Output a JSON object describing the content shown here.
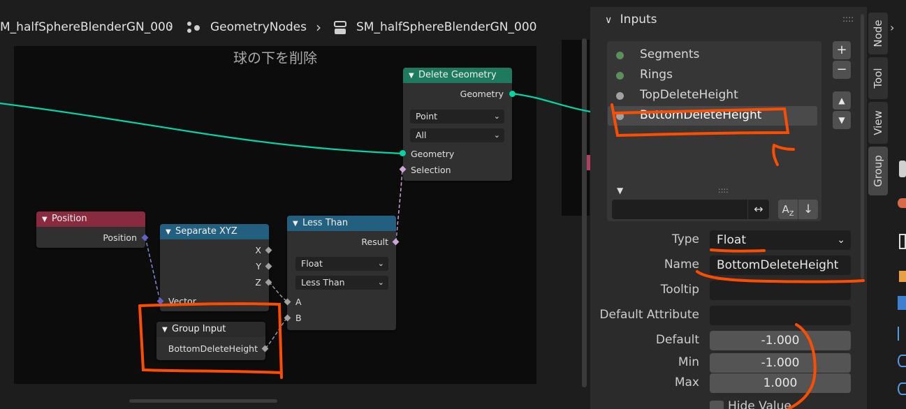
{
  "breadcrumb": {
    "object_name": "M_halfSphereBlenderGN_000",
    "modifier_name": "GeometryNodes",
    "tree_name": "SM_halfSphereBlenderGN_000"
  },
  "frame": {
    "label": "球の下を削除"
  },
  "nodes": {
    "delete_geometry": {
      "title": "Delete Geometry",
      "output_geometry": "Geometry",
      "domain_select": "Point",
      "mode_select": "All",
      "input_geometry": "Geometry",
      "input_selection": "Selection"
    },
    "position": {
      "title": "Position",
      "output": "Position"
    },
    "separate_xyz": {
      "title": "Separate XYZ",
      "out_x": "X",
      "out_y": "Y",
      "out_z": "Z",
      "input_vector": "Vector"
    },
    "less_than": {
      "title": "Less Than",
      "output": "Result",
      "type_select": "Float",
      "op_select": "Less Than",
      "input_a": "A",
      "input_b": "B"
    },
    "group_input": {
      "title": "Group Input",
      "output": "BottomDeleteHeight"
    }
  },
  "panel": {
    "section_title": "Inputs",
    "inputs": [
      {
        "name": "Segments",
        "color": "#5b8f5b"
      },
      {
        "name": "Rings",
        "color": "#5b8f5b"
      },
      {
        "name": "TopDeleteHeight",
        "color": "#a1a1a1"
      },
      {
        "name": "BottomDeleteHeight",
        "color": "#a1a1a1",
        "selected": true
      }
    ],
    "filter_value": "",
    "labels": {
      "type": "Type",
      "name": "Name",
      "tooltip": "Tooltip",
      "default_attribute": "Default Attribute",
      "default": "Default",
      "min": "Min",
      "max": "Max",
      "hide_value": "Hide Value"
    },
    "values": {
      "type": "Float",
      "name": "BottomDeleteHeight",
      "tooltip": "",
      "default_attribute": "",
      "default": "-1.000",
      "min": "-1.000",
      "max": "1.000"
    }
  },
  "tabs": [
    "Node",
    "Tool",
    "View",
    "Group"
  ],
  "colors": {
    "geometry_socket": "#00d6a3",
    "bool_socket": "#cca6d6",
    "vector_socket": "#6363c7",
    "float_socket": "#a1a1a1",
    "annotation": "#ff4d00",
    "geometry_header": "#1e7a5d",
    "converter_header": "#23607f",
    "input_header": "#8a2a41",
    "group_header": "#2b2b2b"
  }
}
